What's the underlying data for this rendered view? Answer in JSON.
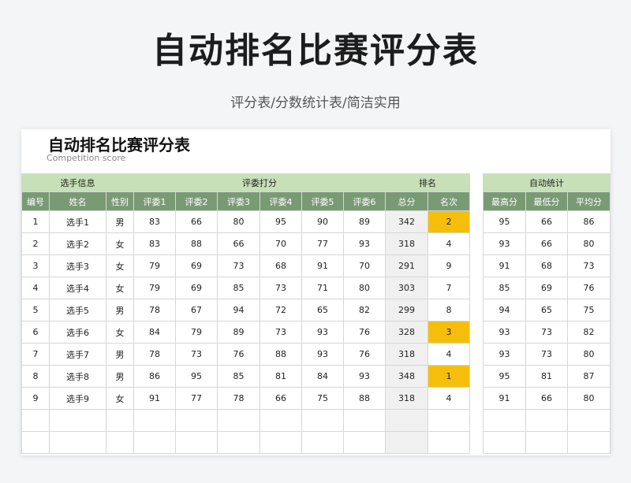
{
  "page": {
    "title": "自动排名比赛评分表",
    "subtitle": "评分表/分数统计表/简洁实用"
  },
  "sheet": {
    "title": "自动排名比赛评分表",
    "subtitle": "Competition score"
  },
  "groups": {
    "info": "选手信息",
    "judges": "评委打分",
    "rank": "排名",
    "stats": "自动统计"
  },
  "headers": [
    "编号",
    "姓名",
    "性别",
    "评委1",
    "评委2",
    "评委3",
    "评委4",
    "评委5",
    "评委6",
    "总分",
    "名次"
  ],
  "stat_headers": [
    "最高分",
    "最低分",
    "平均分"
  ],
  "rows": [
    {
      "id": "1",
      "name": "选手1",
      "gender": "男",
      "scores": [
        "83",
        "66",
        "80",
        "95",
        "90",
        "89"
      ],
      "total": "342",
      "rank": "2",
      "highlight": true,
      "stats": [
        "95",
        "66",
        "86"
      ]
    },
    {
      "id": "2",
      "name": "选手2",
      "gender": "女",
      "scores": [
        "83",
        "88",
        "66",
        "70",
        "77",
        "93"
      ],
      "total": "318",
      "rank": "4",
      "highlight": false,
      "stats": [
        "93",
        "66",
        "80"
      ]
    },
    {
      "id": "3",
      "name": "选手3",
      "gender": "女",
      "scores": [
        "79",
        "69",
        "73",
        "68",
        "91",
        "70"
      ],
      "total": "291",
      "rank": "9",
      "highlight": false,
      "stats": [
        "91",
        "68",
        "73"
      ]
    },
    {
      "id": "4",
      "name": "选手4",
      "gender": "女",
      "scores": [
        "79",
        "69",
        "85",
        "73",
        "71",
        "80"
      ],
      "total": "303",
      "rank": "7",
      "highlight": false,
      "stats": [
        "85",
        "69",
        "76"
      ]
    },
    {
      "id": "5",
      "name": "选手5",
      "gender": "男",
      "scores": [
        "78",
        "67",
        "94",
        "72",
        "65",
        "82"
      ],
      "total": "299",
      "rank": "8",
      "highlight": false,
      "stats": [
        "94",
        "65",
        "75"
      ]
    },
    {
      "id": "6",
      "name": "选手6",
      "gender": "女",
      "scores": [
        "84",
        "79",
        "89",
        "73",
        "93",
        "76"
      ],
      "total": "328",
      "rank": "3",
      "highlight": true,
      "stats": [
        "93",
        "73",
        "82"
      ]
    },
    {
      "id": "7",
      "name": "选手7",
      "gender": "男",
      "scores": [
        "78",
        "73",
        "76",
        "88",
        "93",
        "76"
      ],
      "total": "318",
      "rank": "4",
      "highlight": false,
      "stats": [
        "93",
        "73",
        "80"
      ]
    },
    {
      "id": "8",
      "name": "选手8",
      "gender": "男",
      "scores": [
        "86",
        "95",
        "85",
        "81",
        "84",
        "93"
      ],
      "total": "348",
      "rank": "1",
      "highlight": true,
      "stats": [
        "95",
        "81",
        "87"
      ]
    },
    {
      "id": "9",
      "name": "选手9",
      "gender": "女",
      "scores": [
        "91",
        "77",
        "78",
        "66",
        "75",
        "88"
      ],
      "total": "318",
      "rank": "4",
      "highlight": false,
      "stats": [
        "91",
        "66",
        "80"
      ]
    }
  ],
  "empty_rows": 2,
  "colors": {
    "group_header": "#c7e0b7",
    "column_header": "#7a9a75",
    "rank_highlight": "#f5be0b",
    "total_column": "#f0f0f0"
  }
}
